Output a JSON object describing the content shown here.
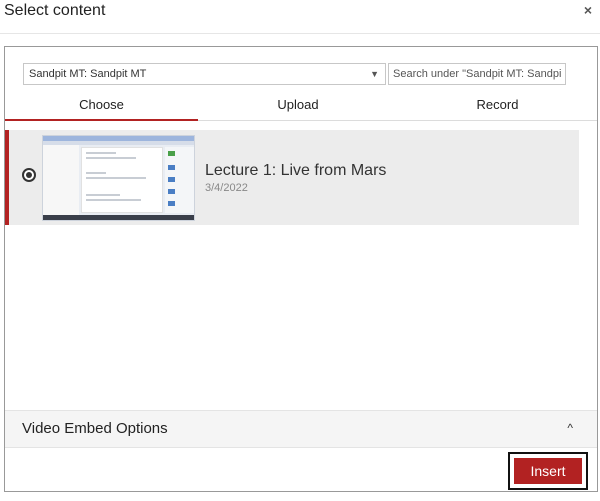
{
  "dialog": {
    "title": "Select content",
    "close_glyph": "×"
  },
  "filters": {
    "source_select": {
      "selected": "Sandpit MT: Sandpit MT",
      "chevron_glyph": "▼"
    },
    "search": {
      "placeholder": "Search under \"Sandpit MT: Sandpit MT\""
    }
  },
  "tabs": [
    {
      "label": "Choose",
      "active": true
    },
    {
      "label": "Upload",
      "active": false
    },
    {
      "label": "Record",
      "active": false
    }
  ],
  "media_list": [
    {
      "title": "Lecture 1: Live from Mars",
      "date": "3/4/2022",
      "selected": true,
      "thumbnail": "video-thumbnail"
    }
  ],
  "embed_options": {
    "label": "Video Embed Options",
    "chevron_glyph": "^",
    "collapsed": true
  },
  "actions": {
    "insert_label": "Insert"
  },
  "colors": {
    "accent": "#b22222",
    "selected_row_bg": "#ececec"
  }
}
